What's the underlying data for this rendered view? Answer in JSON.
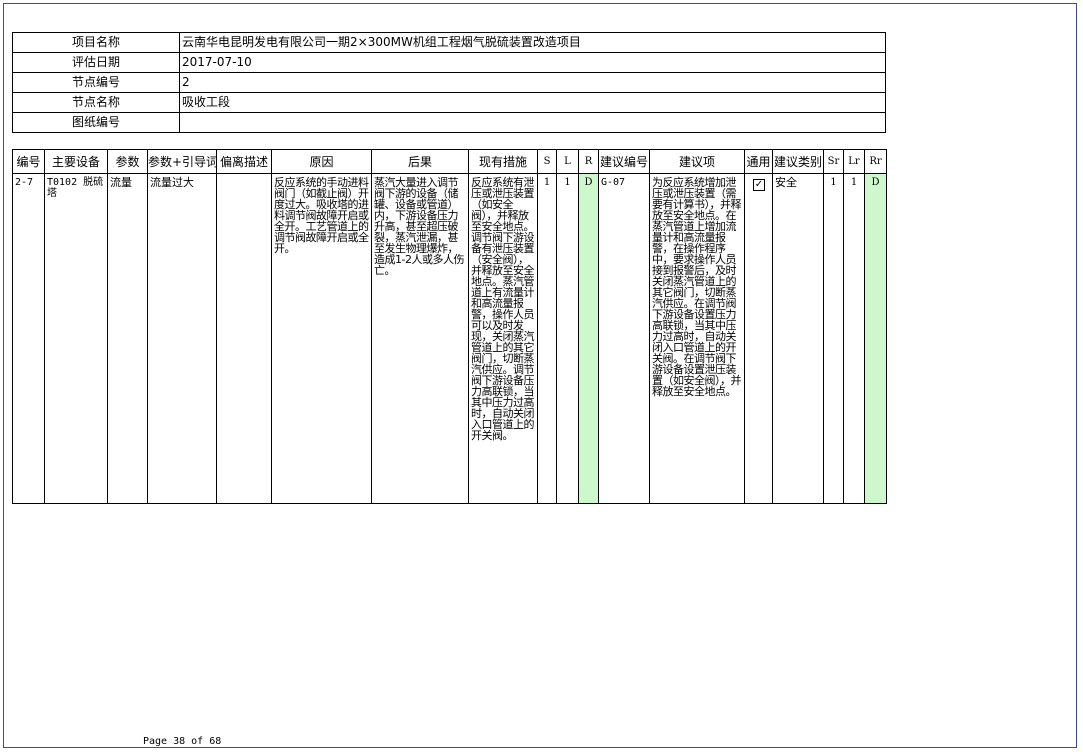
{
  "info": [
    {
      "label": "项目名称",
      "value": "云南华电昆明发电有限公司一期2×300MW机组工程烟气脱硫装置改造项目"
    },
    {
      "label": "评估日期",
      "value": "2017-07-10"
    },
    {
      "label": "节点编号",
      "value": "2"
    },
    {
      "label": "节点名称",
      "value": "吸收工段"
    },
    {
      "label": "图纸编号",
      "value": ""
    }
  ],
  "columns": [
    "编号",
    "主要设备",
    "参数",
    "参数+引导词",
    "偏离描述",
    "原因",
    "后果",
    "现有措施",
    "S",
    "L",
    "R",
    "建议编号",
    "建议项",
    "通用",
    "建议类别",
    "Sr",
    "Lr",
    "Rr"
  ],
  "row": {
    "id": "2-7",
    "equipment": "T0102 脱硫塔",
    "parameter": "流量",
    "guideword": "流量过大",
    "deviation": "",
    "cause": "反应系统的手动进料阀门（如截止阀）开度过大。吸收塔的进料调节阀故障开启或全开。工艺管道上的调节阀故障开启或全开。",
    "consequence": "蒸汽大量进入调节阀下游的设备（储罐、设备或管道）内，下游设备压力升高，甚至超压破裂，蒸汽泄漏，甚至发生物理爆炸，造成1-2人或多人伤亡。",
    "measures": "反应系统有泄压或泄压装置（如安全阀），并释放至安全地点。调节阀下游设备有泄压装置（安全阀），并释放至安全地点。蒸汽管道上有流量计和高流量报警，操作人员可以及时发现，关闭蒸汽管道上的其它阀门，切断蒸汽供应。调节阀下游设备压力高联锁，当其中压力过高时，自动关闭入口管道上的开关阀。",
    "S": "1",
    "L": "1",
    "R": "D",
    "rec_id": "G-07",
    "recommendation": "为反应系统增加泄压或泄压装置（需要有计算书），并释放至安全地点。在蒸汽管道上增加流量计和高流量报警，在操作程序中，要求操作人员接到报警后，及时关闭蒸汽管道上的其它阀门，切断蒸汽供应。在调节阀下游设备设置压力高联锁，当其中压力过高时，自动关闭入口管道上的开关阀。在调节阀下游设备设置泄压装置（如安全阀），并释放至安全地点。",
    "general_checked": "✓",
    "category": "安全",
    "Sr": "1",
    "Lr": "1",
    "Rr": "D"
  },
  "footer": "Page 38 of 68",
  "colors": {
    "frame": "#3b4aa8",
    "risk_cell": "#ccf8cc"
  }
}
